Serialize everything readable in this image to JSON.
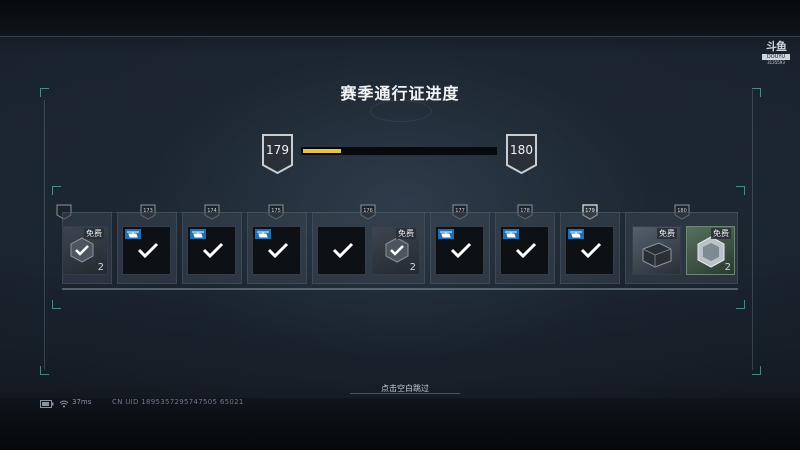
{
  "colors": {
    "accent": "#e8c34a",
    "frame": "#7fd6cc"
  },
  "title": "赛季通行证进度",
  "progress": {
    "current_level": "179",
    "next_level": "180",
    "fill_fraction": 0.2
  },
  "logo": {
    "line1": "斗鱼",
    "line2": "DOUYU",
    "line3": "3135593"
  },
  "levels": [
    "173",
    "174",
    "175",
    "176",
    "177",
    "178",
    "179",
    "180"
  ],
  "cards": [
    {
      "free": "免费",
      "qty": "2"
    },
    {
      "free": "免费",
      "qty": "2"
    },
    {
      "free": "免费"
    },
    {
      "free": "免费",
      "qty": "2"
    }
  ],
  "skip_hint": "点击空白跳过",
  "status": {
    "ping": "37ms",
    "uid": "CN UID 1895357295747505 65021"
  },
  "icons": [
    "shield-icon",
    "checkmark-icon",
    "helicopter-icon",
    "wifi-icon",
    "battery-icon"
  ]
}
